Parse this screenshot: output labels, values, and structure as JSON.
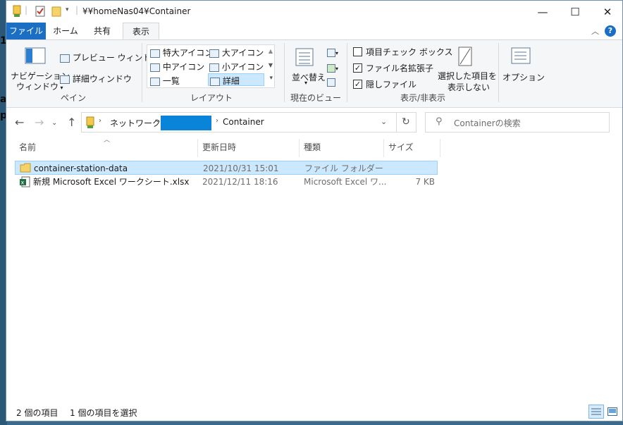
{
  "window": {
    "title": "¥¥homeNas04¥Container",
    "minimize": "—",
    "maximize": "☐",
    "close": "✕"
  },
  "tabs": [
    "ファイル",
    "ホーム",
    "共有",
    "表示"
  ],
  "ribbon": {
    "pane": {
      "nav_pane_line1": "ナビゲーション",
      "nav_pane_line2": "ウィンドウ",
      "preview_pane": "プレビュー ウィンドウ",
      "details_pane": "詳細ウィンドウ",
      "label": "ペイン"
    },
    "layout": {
      "options": [
        "特大アイコン",
        "大アイコン",
        "中アイコン",
        "小アイコン",
        "一覧",
        "詳細"
      ],
      "selected": "詳細",
      "label": "レイアウト"
    },
    "current_view": {
      "sort": "並べ替え",
      "label": "現在のビュー"
    },
    "show_hide": {
      "item_checkboxes": "項目チェック ボックス",
      "item_checkboxes_checked": false,
      "file_extensions": "ファイル名拡張子",
      "file_extensions_checked": true,
      "hidden_items": "隠しファイル",
      "hidden_items_checked": true,
      "hide_selected_line1": "選択した項目を",
      "hide_selected_line2": "表示しない",
      "label": "表示/非表示"
    },
    "options": "オプション"
  },
  "address": {
    "network": "ネットワーク",
    "redacted_color": "#0a84d8",
    "folder": "Container"
  },
  "search": {
    "placeholder": "Containerの検索"
  },
  "columns": {
    "name": "名前",
    "modified": "更新日時",
    "type": "種類",
    "size": "サイズ"
  },
  "files": [
    {
      "name": "container-station-data",
      "modified": "2021/10/31 15:01",
      "type": "ファイル フォルダー",
      "size": "",
      "selected": true
    },
    {
      "name": "新規 Microsoft Excel ワークシート.xlsx",
      "modified": "2021/12/11 18:16",
      "type": "Microsoft Excel ワ...",
      "size": "7 KB",
      "selected": false
    }
  ],
  "status": {
    "item_count": "2 個の項目",
    "selected_count": "1 個の項目を選択"
  },
  "colors": {
    "accent": "#1a6fc4",
    "selection": "#cce8ff"
  }
}
